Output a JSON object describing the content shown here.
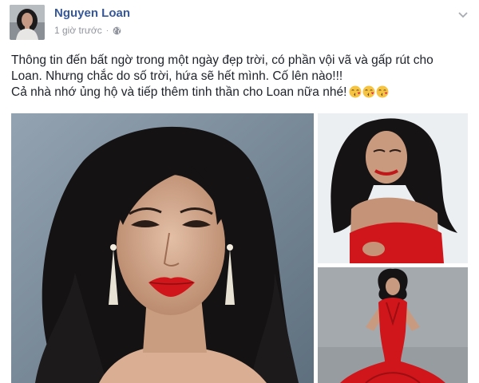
{
  "post": {
    "author": {
      "name": "Nguyen Loan"
    },
    "timestamp": "1 giờ trước",
    "separator": "·",
    "privacy_icon": "globe-icon",
    "menu_icon": "chevron-down-icon",
    "text_lines": [
      "Thông tin đến bất ngờ trong một ngày đẹp trời, có phần vội vã và gấp rút cho Loan. Nhưng chắc do số trời, hứa sẽ hết mình. Cố lên nào!!!",
      "Cả nhà nhớ ủng hộ và tiếp thêm tinh thần cho Loan nữa nhé!"
    ],
    "emojis": [
      "kiss-emoji",
      "kiss-emoji",
      "kiss-emoji"
    ],
    "photos": [
      {
        "name": "woman-portrait-red-lips",
        "background": "#7b8d9c"
      },
      {
        "name": "woman-red-dress-portrait",
        "background": "#eceff2"
      },
      {
        "name": "woman-red-mermaid-gown",
        "background": "#a4a9ae"
      }
    ]
  },
  "colors": {
    "author_link": "#365899",
    "body_text": "#1d2129",
    "meta_text": "#90949c",
    "accent_red": "#d0161b"
  }
}
